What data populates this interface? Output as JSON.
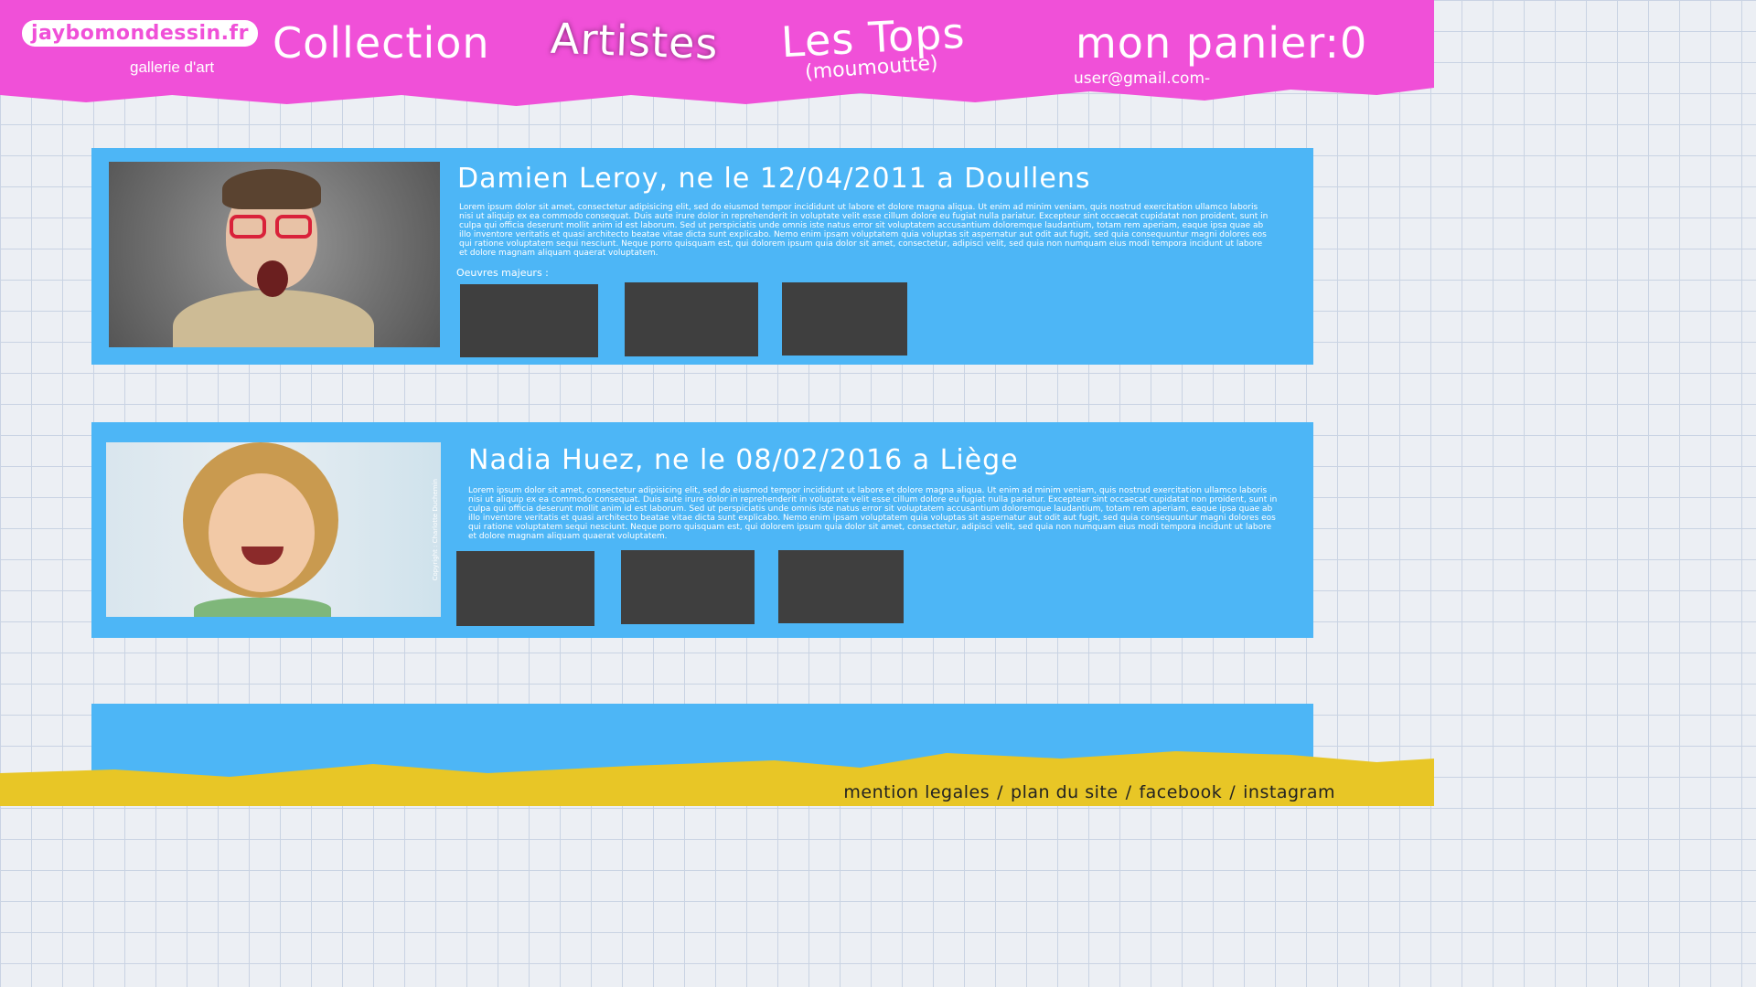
{
  "header": {
    "logo_name": "jaybomondessin.fr",
    "logo_sub": "gallerie d'art",
    "nav": {
      "collection": "Collection",
      "artistes": "Artistes",
      "tops": "Les Tops",
      "tops_sub": "(moumoutte)",
      "cart": "mon panier:0"
    },
    "user_email": "user@gmail.com-"
  },
  "artists": [
    {
      "name": "Damien Leroy, ne le 12/04/2011 a Doullens",
      "bio": "Lorem ipsum dolor sit amet, consectetur adipisicing elit, sed do eiusmod tempor incididunt ut labore et dolore magna aliqua. Ut enim ad minim veniam, quis nostrud exercitation ullamco laboris nisi ut aliquip ex ea commodo consequat. Duis aute irure dolor in reprehenderit in voluptate velit esse cillum dolore eu fugiat nulla pariatur. Excepteur sint occaecat cupidatat non proident, sunt in culpa qui officia deserunt mollit anim id est laborum. Sed ut perspiciatis unde omnis iste natus error sit voluptatem accusantium doloremque laudantium, totam rem aperiam, eaque ipsa quae ab illo inventore veritatis et quasi architecto beatae vitae dicta sunt explicabo. Nemo enim ipsam voluptatem quia voluptas sit aspernatur aut odit aut fugit, sed quia consequuntur magni dolores eos qui ratione voluptatem sequi nesciunt. Neque porro quisquam est, qui dolorem ipsum quia dolor sit amet, consectetur, adipisci velit, sed quia non numquam eius modi tempora incidunt ut labore et dolore magnam aliquam quaerat voluptatem.",
      "works_label": "Oeuvres majeurs :"
    },
    {
      "name": "Nadia Huez, ne le 08/02/2016 a Liège",
      "bio": "Lorem ipsum dolor sit amet, consectetur adipisicing elit, sed do eiusmod tempor incididunt ut labore et dolore magna aliqua. Ut enim ad minim veniam, quis nostrud exercitation ullamco laboris nisi ut aliquip ex ea commodo consequat. Duis aute irure dolor in reprehenderit in voluptate velit esse cillum dolore eu fugiat nulla pariatur. Excepteur sint occaecat cupidatat non proident, sunt in culpa qui officia deserunt mollit anim id est laborum. Sed ut perspiciatis unde omnis iste natus error sit voluptatem accusantium doloremque laudantium, totam rem aperiam, eaque ipsa quae ab illo inventore veritatis et quasi architecto beatae vitae dicta sunt explicabo. Nemo enim ipsam voluptatem quia voluptas sit aspernatur aut odit aut fugit, sed quia consequuntur magni dolores eos qui ratione voluptatem sequi nesciunt. Neque porro quisquam est, qui dolorem ipsum quia dolor sit amet, consectetur, adipisci velit, sed quia non numquam eius modi tempora incidunt ut labore et dolore magnam aliquam quaerat voluptatem.",
      "photo_copyright": "Copyright : Charlotte Duchemin"
    }
  ],
  "footer": {
    "mentions": "mention legales",
    "plan": "plan du site",
    "facebook": "facebook",
    "instagram": "instagram",
    "separator": "/"
  },
  "colors": {
    "header": "#f050d8",
    "card": "#4db6f6",
    "footer": "#e8c626",
    "work_placeholder": "#3f3f3f"
  }
}
